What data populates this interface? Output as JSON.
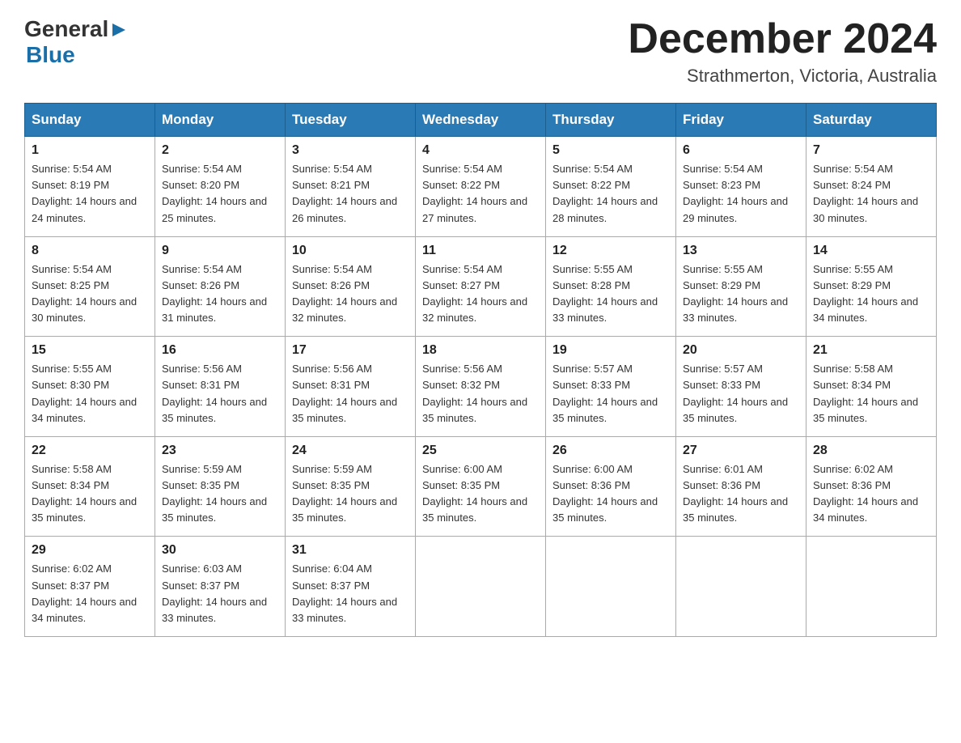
{
  "header": {
    "logo_general": "General",
    "logo_arrow": "▶",
    "logo_blue": "Blue",
    "month_title": "December 2024",
    "location": "Strathmerton, Victoria, Australia"
  },
  "columns": [
    "Sunday",
    "Monday",
    "Tuesday",
    "Wednesday",
    "Thursday",
    "Friday",
    "Saturday"
  ],
  "weeks": [
    [
      {
        "day": "1",
        "sunrise": "5:54 AM",
        "sunset": "8:19 PM",
        "daylight": "14 hours and 24 minutes."
      },
      {
        "day": "2",
        "sunrise": "5:54 AM",
        "sunset": "8:20 PM",
        "daylight": "14 hours and 25 minutes."
      },
      {
        "day": "3",
        "sunrise": "5:54 AM",
        "sunset": "8:21 PM",
        "daylight": "14 hours and 26 minutes."
      },
      {
        "day": "4",
        "sunrise": "5:54 AM",
        "sunset": "8:22 PM",
        "daylight": "14 hours and 27 minutes."
      },
      {
        "day": "5",
        "sunrise": "5:54 AM",
        "sunset": "8:22 PM",
        "daylight": "14 hours and 28 minutes."
      },
      {
        "day": "6",
        "sunrise": "5:54 AM",
        "sunset": "8:23 PM",
        "daylight": "14 hours and 29 minutes."
      },
      {
        "day": "7",
        "sunrise": "5:54 AM",
        "sunset": "8:24 PM",
        "daylight": "14 hours and 30 minutes."
      }
    ],
    [
      {
        "day": "8",
        "sunrise": "5:54 AM",
        "sunset": "8:25 PM",
        "daylight": "14 hours and 30 minutes."
      },
      {
        "day": "9",
        "sunrise": "5:54 AM",
        "sunset": "8:26 PM",
        "daylight": "14 hours and 31 minutes."
      },
      {
        "day": "10",
        "sunrise": "5:54 AM",
        "sunset": "8:26 PM",
        "daylight": "14 hours and 32 minutes."
      },
      {
        "day": "11",
        "sunrise": "5:54 AM",
        "sunset": "8:27 PM",
        "daylight": "14 hours and 32 minutes."
      },
      {
        "day": "12",
        "sunrise": "5:55 AM",
        "sunset": "8:28 PM",
        "daylight": "14 hours and 33 minutes."
      },
      {
        "day": "13",
        "sunrise": "5:55 AM",
        "sunset": "8:29 PM",
        "daylight": "14 hours and 33 minutes."
      },
      {
        "day": "14",
        "sunrise": "5:55 AM",
        "sunset": "8:29 PM",
        "daylight": "14 hours and 34 minutes."
      }
    ],
    [
      {
        "day": "15",
        "sunrise": "5:55 AM",
        "sunset": "8:30 PM",
        "daylight": "14 hours and 34 minutes."
      },
      {
        "day": "16",
        "sunrise": "5:56 AM",
        "sunset": "8:31 PM",
        "daylight": "14 hours and 35 minutes."
      },
      {
        "day": "17",
        "sunrise": "5:56 AM",
        "sunset": "8:31 PM",
        "daylight": "14 hours and 35 minutes."
      },
      {
        "day": "18",
        "sunrise": "5:56 AM",
        "sunset": "8:32 PM",
        "daylight": "14 hours and 35 minutes."
      },
      {
        "day": "19",
        "sunrise": "5:57 AM",
        "sunset": "8:33 PM",
        "daylight": "14 hours and 35 minutes."
      },
      {
        "day": "20",
        "sunrise": "5:57 AM",
        "sunset": "8:33 PM",
        "daylight": "14 hours and 35 minutes."
      },
      {
        "day": "21",
        "sunrise": "5:58 AM",
        "sunset": "8:34 PM",
        "daylight": "14 hours and 35 minutes."
      }
    ],
    [
      {
        "day": "22",
        "sunrise": "5:58 AM",
        "sunset": "8:34 PM",
        "daylight": "14 hours and 35 minutes."
      },
      {
        "day": "23",
        "sunrise": "5:59 AM",
        "sunset": "8:35 PM",
        "daylight": "14 hours and 35 minutes."
      },
      {
        "day": "24",
        "sunrise": "5:59 AM",
        "sunset": "8:35 PM",
        "daylight": "14 hours and 35 minutes."
      },
      {
        "day": "25",
        "sunrise": "6:00 AM",
        "sunset": "8:35 PM",
        "daylight": "14 hours and 35 minutes."
      },
      {
        "day": "26",
        "sunrise": "6:00 AM",
        "sunset": "8:36 PM",
        "daylight": "14 hours and 35 minutes."
      },
      {
        "day": "27",
        "sunrise": "6:01 AM",
        "sunset": "8:36 PM",
        "daylight": "14 hours and 35 minutes."
      },
      {
        "day": "28",
        "sunrise": "6:02 AM",
        "sunset": "8:36 PM",
        "daylight": "14 hours and 34 minutes."
      }
    ],
    [
      {
        "day": "29",
        "sunrise": "6:02 AM",
        "sunset": "8:37 PM",
        "daylight": "14 hours and 34 minutes."
      },
      {
        "day": "30",
        "sunrise": "6:03 AM",
        "sunset": "8:37 PM",
        "daylight": "14 hours and 33 minutes."
      },
      {
        "day": "31",
        "sunrise": "6:04 AM",
        "sunset": "8:37 PM",
        "daylight": "14 hours and 33 minutes."
      },
      null,
      null,
      null,
      null
    ]
  ],
  "labels": {
    "sunrise_prefix": "Sunrise: ",
    "sunset_prefix": "Sunset: ",
    "daylight_prefix": "Daylight: "
  }
}
